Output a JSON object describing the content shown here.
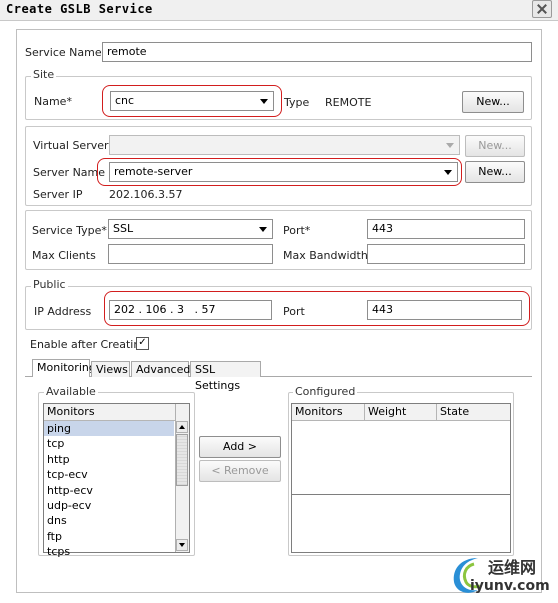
{
  "window": {
    "title": "Create GSLB Service"
  },
  "service": {
    "name_label": "Service Name*",
    "name_value": "remote"
  },
  "site": {
    "legend": "Site",
    "name_label": "Name*",
    "name_value": "cnc",
    "type_label": "Type",
    "type_value": "REMOTE",
    "new_button": "New..."
  },
  "server": {
    "virtual_label": "Virtual Server",
    "virtual_value": "",
    "virtual_new_button": "New...",
    "name_label": "Server Name",
    "name_value": "remote-server",
    "new_button": "New...",
    "ip_label": "Server IP",
    "ip_value": "202.106.3.57"
  },
  "service_params": {
    "type_label": "Service Type*",
    "type_value": "SSL",
    "port_label": "Port*",
    "port_value": "443",
    "max_clients_label": "Max Clients",
    "max_clients_value": "",
    "max_bandwidth_label": "Max Bandwidth",
    "max_bandwidth_value": ""
  },
  "public": {
    "legend": "Public",
    "ip_label": "IP Address",
    "ip_value": "202 . 106 . 3   . 57",
    "port_label": "Port",
    "port_value": "443"
  },
  "enable": {
    "label": "Enable after Creating",
    "checked": true,
    "check_glyph": "✓"
  },
  "tabs": [
    {
      "label": "Monitoring",
      "active": true
    },
    {
      "label": "Views",
      "active": false
    },
    {
      "label": "Advanced",
      "active": false
    },
    {
      "label": "SSL Settings",
      "active": false
    }
  ],
  "available": {
    "legend": "Available",
    "header": "Monitors",
    "items": [
      "ping",
      "tcp",
      "http",
      "tcp-ecv",
      "http-ecv",
      "udp-ecv",
      "dns",
      "ftp",
      "tcps"
    ]
  },
  "actions": {
    "add": "Add >",
    "remove": "< Remove"
  },
  "configured": {
    "legend": "Configured",
    "columns": [
      "Monitors",
      "Weight",
      "State"
    ]
  },
  "watermark": {
    "site": "运维网",
    "domain": "iyunv.com"
  },
  "colors": {
    "highlight": "#d21e1e",
    "selection": "#c8d5ea"
  }
}
